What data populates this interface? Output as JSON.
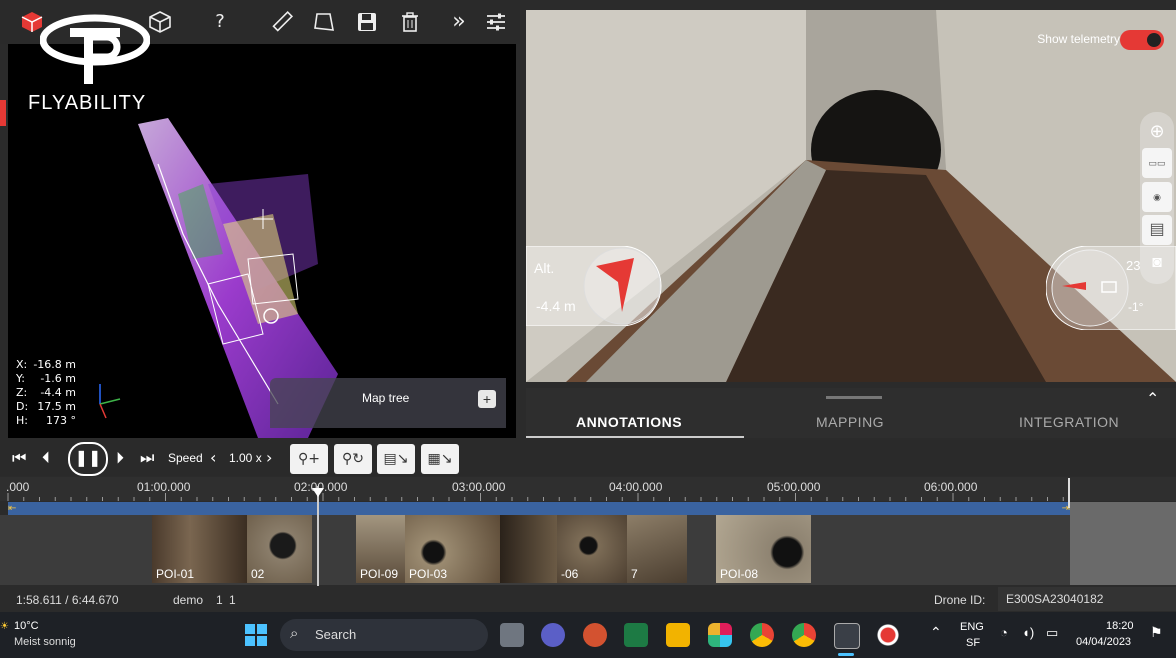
{
  "brand": {
    "logo_text": "FLYABILITY"
  },
  "toolbar": {
    "help": "?"
  },
  "view3d": {
    "coords": [
      {
        "k": "X:",
        "v": "-16.8 m"
      },
      {
        "k": "Y:",
        "v": "-1.6 m"
      },
      {
        "k": "Z:",
        "v": "-4.4 m"
      },
      {
        "k": "D:",
        "v": "17.5 m"
      },
      {
        "k": "H:",
        "v": "173 °"
      }
    ],
    "map_tree_label": "Map tree",
    "map_tree_add": "+"
  },
  "camera": {
    "show_telemetry_label": "Show telemetry",
    "telemetry_on": true,
    "alt_label": "Alt.",
    "alt_value": "-4.4 m",
    "heading_value": "23",
    "pitch_value": "-1°"
  },
  "tabs": [
    "ANNOTATIONS",
    "MAPPING",
    "INTEGRATION"
  ],
  "active_tab": "ANNOTATIONS",
  "controls": {
    "speed_label": "Speed",
    "speed_value": "1.00 x"
  },
  "timeline": {
    "ticks": [
      ".000",
      "01:00.000",
      "02:00.000",
      "03:00.000",
      "04:00.000",
      "05:00.000",
      "06:00.000"
    ],
    "pois": [
      "POI-01",
      "02",
      "POI-09",
      "POI-03",
      "",
      "-06",
      "7",
      "POI-08"
    ]
  },
  "status": {
    "time": "1:58.611 / 6:44.670",
    "session": "demo",
    "n1": "1",
    "n2": "1",
    "drone_id_label": "Drone ID:",
    "drone_id": "E300SA23040182"
  },
  "taskbar": {
    "temperature": "10°C",
    "weather": "Meist sonnig",
    "search": "Search",
    "lang1": "ENG",
    "lang2": "SF",
    "time": "18:20",
    "date": "04/04/2023"
  },
  "colors": {
    "accent": "#e53935",
    "track": "#3a63a0"
  }
}
